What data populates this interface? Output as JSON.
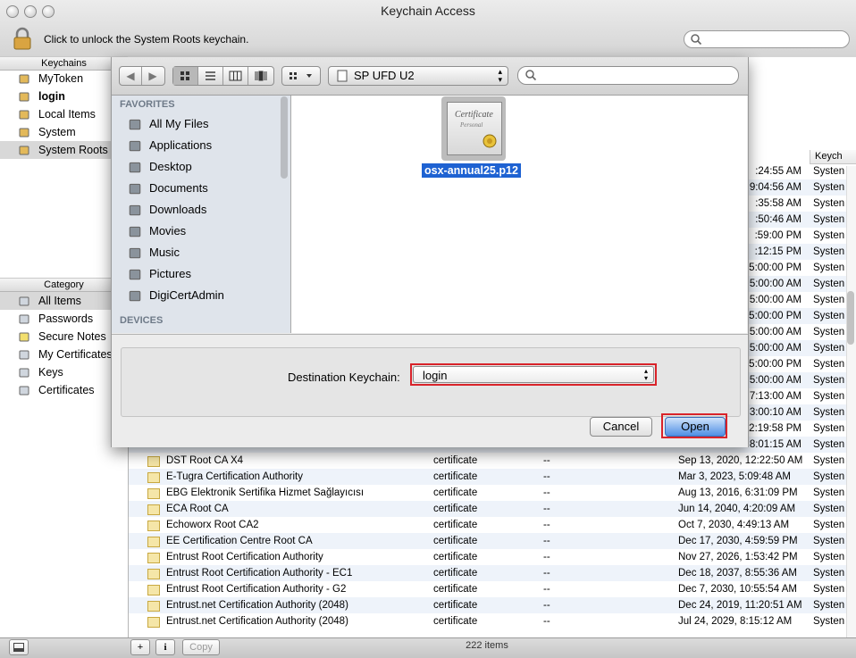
{
  "window": {
    "title": "Keychain Access"
  },
  "toolbar": {
    "lock_message": "Click to unlock the System Roots keychain.",
    "search_placeholder": ""
  },
  "keychains": {
    "header": "Keychains",
    "items": [
      {
        "label": "MyToken",
        "bold": false,
        "selected": false
      },
      {
        "label": "login",
        "bold": true,
        "selected": false
      },
      {
        "label": "Local Items",
        "bold": false,
        "selected": false
      },
      {
        "label": "System",
        "bold": false,
        "selected": false
      },
      {
        "label": "System Roots",
        "bold": false,
        "selected": true
      }
    ]
  },
  "category": {
    "header": "Category",
    "items": [
      {
        "label": "All Items",
        "selected": true
      },
      {
        "label": "Passwords",
        "selected": false
      },
      {
        "label": "Secure Notes",
        "selected": false
      },
      {
        "label": "My Certificates",
        "selected": false
      },
      {
        "label": "Keys",
        "selected": false
      },
      {
        "label": "Certificates",
        "selected": false
      }
    ]
  },
  "table": {
    "keychain_col_header": "Keych",
    "partial_rows": [
      {
        "date": ":24:55 AM",
        "keychain": "Systen"
      },
      {
        "date": "9:04:56 AM",
        "keychain": "Systen"
      },
      {
        "date": ":35:58 AM",
        "keychain": "Systen"
      },
      {
        "date": ":50:46 AM",
        "keychain": "Systen"
      },
      {
        "date": ":59:00 PM",
        "keychain": "Systen"
      },
      {
        "date": ":12:15 PM",
        "keychain": "Systen"
      },
      {
        "date": "5:00:00 PM",
        "keychain": "Systen"
      },
      {
        "date": "5:00:00 AM",
        "keychain": "Systen"
      },
      {
        "date": "5:00:00 AM",
        "keychain": "Systen"
      },
      {
        "date": "5:00:00 PM",
        "keychain": "Systen"
      },
      {
        "date": "5:00:00 AM",
        "keychain": "Systen"
      },
      {
        "date": "5:00:00 AM",
        "keychain": "Systen"
      },
      {
        "date": "5:00:00 PM",
        "keychain": "Systen"
      },
      {
        "date": "5:00:00 AM",
        "keychain": "Systen"
      },
      {
        "date": "7:13:00 AM",
        "keychain": "Systen"
      },
      {
        "date": "3:00:10 AM",
        "keychain": "Systen"
      },
      {
        "date": "2:19:58 PM",
        "keychain": "Systen"
      },
      {
        "date": "8:01:15 AM",
        "keychain": "Systen"
      }
    ],
    "rows": [
      {
        "name": "DST Root CA X4",
        "kind": "certificate",
        "date_modified": "--",
        "expires": "Sep 13, 2020, 12:22:50 AM",
        "keychain": "Systen"
      },
      {
        "name": "E-Tugra Certification Authority",
        "kind": "certificate",
        "date_modified": "--",
        "expires": "Mar 3, 2023, 5:09:48 AM",
        "keychain": "Systen"
      },
      {
        "name": "EBG Elektronik Sertifika Hizmet Sağlayıcısı",
        "kind": "certificate",
        "date_modified": "--",
        "expires": "Aug 13, 2016, 6:31:09 PM",
        "keychain": "Systen"
      },
      {
        "name": "ECA Root CA",
        "kind": "certificate",
        "date_modified": "--",
        "expires": "Jun 14, 2040, 4:20:09 AM",
        "keychain": "Systen"
      },
      {
        "name": "Echoworx Root CA2",
        "kind": "certificate",
        "date_modified": "--",
        "expires": "Oct 7, 2030, 4:49:13 AM",
        "keychain": "Systen"
      },
      {
        "name": "EE Certification Centre Root CA",
        "kind": "certificate",
        "date_modified": "--",
        "expires": "Dec 17, 2030, 4:59:59 PM",
        "keychain": "Systen"
      },
      {
        "name": "Entrust Root Certification Authority",
        "kind": "certificate",
        "date_modified": "--",
        "expires": "Nov 27, 2026, 1:53:42 PM",
        "keychain": "Systen"
      },
      {
        "name": "Entrust Root Certification Authority - EC1",
        "kind": "certificate",
        "date_modified": "--",
        "expires": "Dec 18, 2037, 8:55:36 AM",
        "keychain": "Systen"
      },
      {
        "name": "Entrust Root Certification Authority - G2",
        "kind": "certificate",
        "date_modified": "--",
        "expires": "Dec 7, 2030, 10:55:54 AM",
        "keychain": "Systen"
      },
      {
        "name": "Entrust.net Certification Authority (2048)",
        "kind": "certificate",
        "date_modified": "--",
        "expires": "Dec 24, 2019, 11:20:51 AM",
        "keychain": "Systen"
      },
      {
        "name": "Entrust.net Certification Authority (2048)",
        "kind": "certificate",
        "date_modified": "--",
        "expires": "Jul 24, 2029, 8:15:12 AM",
        "keychain": "Systen"
      }
    ]
  },
  "statusbar": {
    "copy_label": "Copy",
    "item_count": "222 items"
  },
  "dialog": {
    "location": "SP UFD U2",
    "search_placeholder": "",
    "favorites_header": "FAVORITES",
    "favorites": [
      {
        "label": "All My Files",
        "icon": "all-files-icon"
      },
      {
        "label": "Applications",
        "icon": "applications-icon"
      },
      {
        "label": "Desktop",
        "icon": "desktop-icon"
      },
      {
        "label": "Documents",
        "icon": "documents-icon"
      },
      {
        "label": "Downloads",
        "icon": "downloads-icon"
      },
      {
        "label": "Movies",
        "icon": "movies-icon"
      },
      {
        "label": "Music",
        "icon": "music-icon"
      },
      {
        "label": "Pictures",
        "icon": "pictures-icon"
      },
      {
        "label": "DigiCertAdmin",
        "icon": "home-icon"
      }
    ],
    "devices_header": "DEVICES",
    "file": {
      "name": "osx-annual25.p12",
      "icon_caption": "Certificate",
      "icon_subcaption": "Personal"
    },
    "destination_label": "Destination Keychain:",
    "destination_value": "login",
    "cancel_label": "Cancel",
    "open_label": "Open"
  },
  "colors": {
    "selection": "#1e62d2",
    "highlight_box": "#d9232a",
    "row_alt": "#eef3fa"
  }
}
